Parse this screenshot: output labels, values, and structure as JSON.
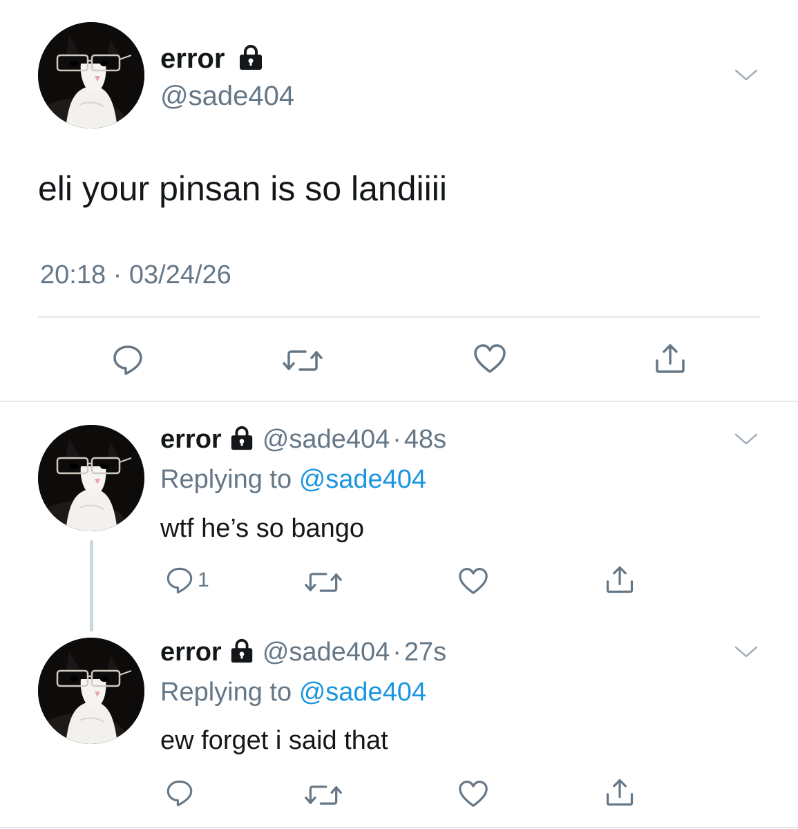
{
  "main_tweet": {
    "display_name": "error",
    "handle": "@sade404",
    "text": "eli your pinsan is so landiiii",
    "time": "20:18",
    "separator": "·",
    "date": "03/24/26"
  },
  "replies": [
    {
      "display_name": "error",
      "handle": "@sade404",
      "separator": "·",
      "age": "48s",
      "replying_prefix": "Replying to",
      "replying_handle": "@sade404",
      "text": "wtf he’s so bango",
      "reply_count": "1"
    },
    {
      "display_name": "error",
      "handle": "@sade404",
      "separator": "·",
      "age": "27s",
      "replying_prefix": "Replying to",
      "replying_handle": "@sade404",
      "text": "ew forget i said that"
    }
  ],
  "icons": [
    "lock-icon",
    "chevron-down-icon",
    "reply-icon",
    "retweet-icon",
    "like-icon",
    "share-icon"
  ],
  "colors": {
    "text": "#14171a",
    "secondary": "#657786",
    "link": "#1b95e0",
    "divider": "#e1e8ed"
  }
}
